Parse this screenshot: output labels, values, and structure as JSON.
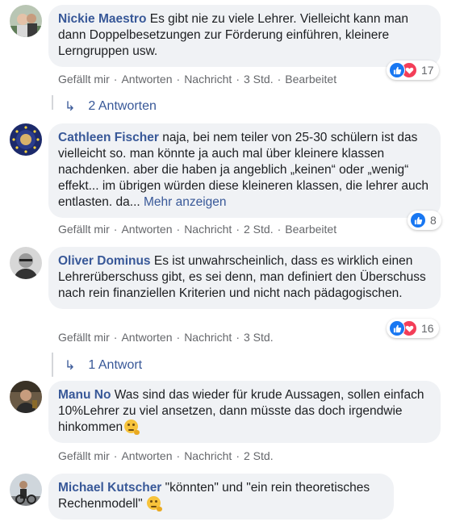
{
  "actions": {
    "like": "Gefällt mir",
    "reply": "Antworten",
    "message": "Nachricht",
    "edited": "Bearbeitet",
    "separator": "·"
  },
  "comments": [
    {
      "author": "Nickie Maestro",
      "text": "Es gibt nie zu viele Lehrer. Vielleicht kann man dann Doppelbesetzungen zur Förderung einführen, kleinere Lerngruppen usw.",
      "time": "3 Std.",
      "reactions": {
        "types": [
          "like-icon",
          "love-icon"
        ],
        "count": "17"
      },
      "replies": "2 Antworten"
    },
    {
      "author": "Cathleen Fischer",
      "text": "naja, bei nem teiler von 25-30 schülern ist das vielleicht so. man könnte ja auch mal über kleinere klassen nachdenken. aber die haben ja angeblich „keinen“ oder „wenig“ effekt... im übrigen würden diese kleineren klassen, die lehrer auch entlasten. da...",
      "more": "Mehr anzeigen",
      "time": "2 Std.",
      "reactions": {
        "types": [
          "like-icon"
        ],
        "count": "8"
      }
    },
    {
      "author": "Oliver Dominus",
      "text": "Es ist unwahrscheinlich, dass es wirklich einen Lehrerüberschuss gibt, es sei denn, man definiert den Überschuss nach rein finanziellen Kriterien und nicht nach pädagogischen.",
      "time": "3 Std.",
      "reactions": {
        "types": [
          "like-icon",
          "love-icon"
        ],
        "count": "16"
      },
      "replies": "1 Antwort"
    },
    {
      "author": "Manu No",
      "text": "Was sind das wieder für krude Aussagen, sollen einfach 10%Lehrer zu viel ansetzen, dann müsste das doch irgendwie hinkommen",
      "emoji": "thinking-face-icon",
      "time": "2 Std."
    },
    {
      "author": "Michael Kutscher",
      "text": "\"könnten\" und \"ein rein theoretisches Rechenmodell\"",
      "emoji": "thinking-face-icon"
    }
  ],
  "colors": {
    "link": "#385898",
    "bubble": "#f0f2f5",
    "meta": "#65676b",
    "like": "#1877f2",
    "love": "#f33e58"
  }
}
